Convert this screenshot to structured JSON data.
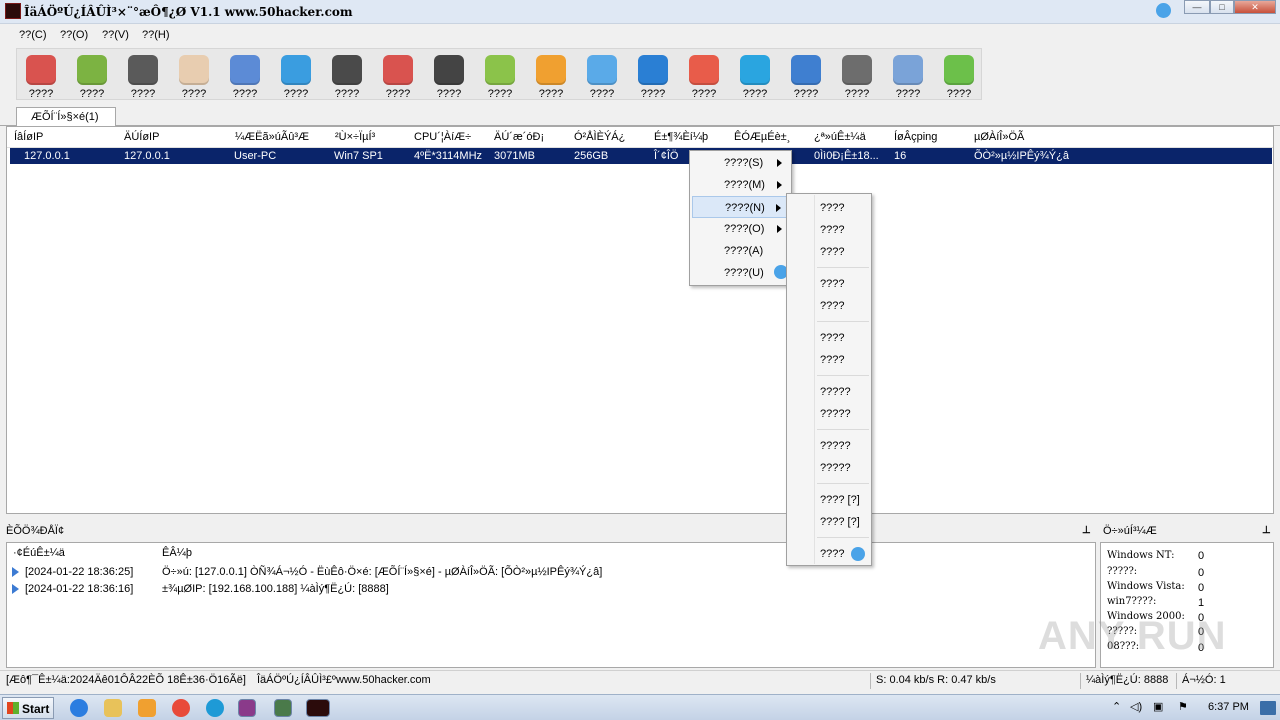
{
  "window": {
    "title": "ÎäÁÖºÚ¿ÍÂÛÌ³×¨°æÔ¶¿Ø V1.1 www.50hacker.com",
    "controls": [
      "—",
      "□",
      "✕"
    ]
  },
  "menu": [
    "??(C)",
    "??(O)",
    "??(V)",
    "??(H)"
  ],
  "toolbar": {
    "buttons": [
      {
        "label": "????",
        "icon": "dictionary-icon",
        "color": "#d9534f"
      },
      {
        "label": "????",
        "icon": "ipod-icon",
        "color": "#7cb342"
      },
      {
        "label": "????",
        "icon": "terminal-icon",
        "color": "#5a5a5a"
      },
      {
        "label": "????",
        "icon": "calculator-icon",
        "color": "#e8cdb0"
      },
      {
        "label": "????",
        "icon": "activity-monitor-icon",
        "color": "#5c8bd6"
      },
      {
        "label": "????",
        "icon": "app-store-icon",
        "color": "#3a9de0"
      },
      {
        "label": "????",
        "icon": "camera-icon",
        "color": "#4a4a4a"
      },
      {
        "label": "????",
        "icon": "microphone-icon",
        "color": "#d9534f"
      },
      {
        "label": "????",
        "icon": "clock-icon",
        "color": "#444444"
      },
      {
        "label": "????",
        "icon": "download-icon",
        "color": "#8bc34a"
      },
      {
        "label": "????",
        "icon": "star-icon",
        "color": "#f0a030"
      },
      {
        "label": "????",
        "icon": "cloud-icon",
        "color": "#5aaae8"
      },
      {
        "label": "????",
        "icon": "chat-icon",
        "color": "#2a7fd4"
      },
      {
        "label": "????",
        "icon": "calendar-icon",
        "color": "#e85c4a"
      },
      {
        "label": "????",
        "icon": "skype-icon",
        "color": "#2aa5e0"
      },
      {
        "label": "????",
        "icon": "globe-icon",
        "color": "#3f7fd0"
      },
      {
        "label": "????",
        "icon": "settings-icon",
        "color": "#6d6d6d"
      },
      {
        "label": "????",
        "icon": "checklist-icon",
        "color": "#7aa3d8"
      },
      {
        "label": "????",
        "icon": "phone-icon",
        "color": "#6cc04a"
      }
    ]
  },
  "tabs": [
    "ÆÕÍ¨Í»§×é(1)"
  ],
  "columns": [
    "ÍâÍøIP",
    "ÄÚÍøIP",
    "¼ÆËã»úÃû³Æ",
    "²Ù×÷ÏµÍ³",
    "CPU´¦ÀíÆ÷",
    "ÄÚ´æ´óÐ¡",
    "Ó²ÅÌÈÝÁ¿",
    "É±¶¾Èí¼þ",
    "ÊÓÆµÉè±¸",
    "¿ª»úÊ±¼ä",
    "ÍøÂçping",
    "µØÀíÎ»ÖÃ"
  ],
  "rows": [
    [
      "127.0.0.1",
      "127.0.0.1",
      "User-PC",
      "Win7 SP1",
      "4ºË*3114MHz",
      "3071MB",
      "256GB",
      "Î´¢ÎÖ",
      "",
      "0Ìì0Ð¡Ê±18...",
      "16",
      "ÕÒ²»µ½IPÊý¾Ý¿â"
    ]
  ],
  "context_menu": {
    "items": [
      {
        "label": "????(S)",
        "has_submenu": true
      },
      {
        "label": "????(M)",
        "has_submenu": true
      },
      {
        "label": "????(N)",
        "has_submenu": true,
        "highlighted": true
      },
      {
        "label": "????(O)",
        "has_submenu": true
      },
      {
        "label": "????(A)",
        "has_submenu": false
      },
      {
        "label": "????(U)",
        "has_submenu": false,
        "icon": "assistant-bubble-icon"
      }
    ],
    "submenu": [
      "????",
      "????",
      "????",
      "????",
      "????",
      "????",
      "????",
      "?????",
      "?????",
      "?????",
      "?????",
      "???? [?]",
      "???? [?]",
      "????"
    ]
  },
  "log": {
    "panel_title": "ÈÕÖ¾ÐÅÏ¢",
    "headers": [
      "·¢ÉúÊ±¼ä",
      "ÊÂ¼þ"
    ],
    "entries": [
      {
        "time": "[2024-01-22 18:36:25]",
        "event": "Ö÷»ú: [127.0.0.1] ÒÑ¾­Á¬½Ó - ËùÊô·Ö×é: [ÆÕÍ¨Í»§×é] - µØÀíÎ»ÖÃ: [ÕÒ²»µ½IPÊý¾Ý¿â]"
      },
      {
        "time": "[2024-01-22 18:36:16]",
        "event": "±¾µØIP: [192.168.100.188] ¼àÌý¶Ë¿Ú: [8888]"
      }
    ]
  },
  "stats": {
    "title": "Ö÷»úÍ³¼Æ",
    "rows": [
      {
        "label": "Windows NT:",
        "value": "0"
      },
      {
        "label": "?????:",
        "value": "0"
      },
      {
        "label": "Windows Vista:",
        "value": "0"
      },
      {
        "label": "win7????:",
        "value": "1"
      },
      {
        "label": "Windows 2000:",
        "value": "0"
      },
      {
        "label": "?????:",
        "value": "0"
      },
      {
        "label": "08???:",
        "value": "0"
      }
    ]
  },
  "statusbar": {
    "left": "[Æô¶¯Ê±¼ä:2024Äê01ÔÂ22ÈÕ 18Ê±36·Ö16Ãë]",
    "site": "ÎäÁÖºÚ¿ÍÂÛÌ³£ºwww.50hacker.com",
    "speed": "S: 0.04 kb/s R: 0.47 kb/s",
    "port": "¼àÌý¶Ë¿Ú: 8888",
    "online": "Á¬½Ó: 1"
  },
  "watermark": "ANY RUN",
  "taskbar": {
    "start_label": "Start",
    "clock": "6:37 PM"
  }
}
